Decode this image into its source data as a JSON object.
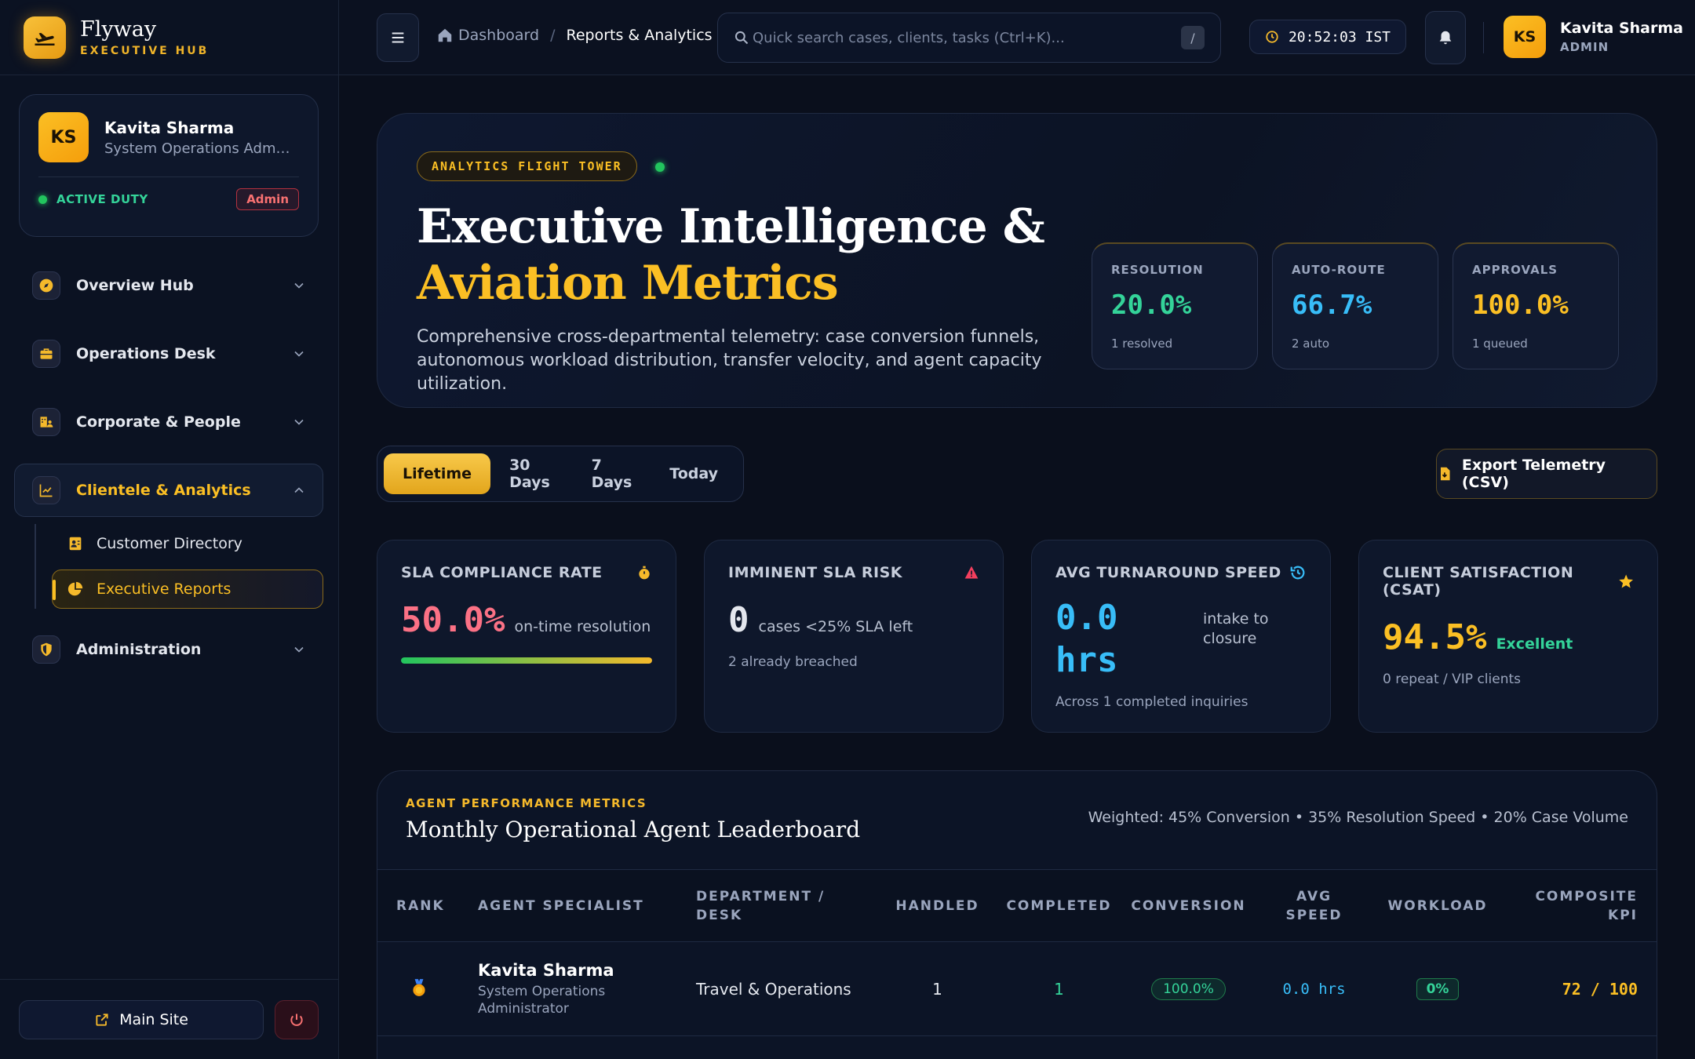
{
  "brand": {
    "name": "Flyway",
    "subtitle": "EXECUTIVE HUB"
  },
  "profile": {
    "initials": "KS",
    "name": "Kavita Sharma",
    "role": "System Operations Admini...",
    "status": "ACTIVE DUTY",
    "badge": "Admin"
  },
  "nav": {
    "overview": "Overview Hub",
    "operations": "Operations Desk",
    "corporate": "Corporate & People",
    "clientele": "Clientele & Analytics",
    "customer_directory": "Customer Directory",
    "executive_reports": "Executive Reports",
    "administration": "Administration"
  },
  "footer": {
    "main_site": "Main Site"
  },
  "topbar": {
    "breadcrumb_home": "Dashboard",
    "breadcrumb_sep": "/",
    "breadcrumb_current": "Reports & Analytics",
    "search_placeholder": "Quick search cases, clients, tasks (Ctrl+K)...",
    "search_shortcut": "/",
    "clock": "20:52:03 IST",
    "user_initials": "KS",
    "user_name": "Kavita Sharma",
    "user_role": "ADMIN"
  },
  "hero": {
    "pill": "ANALYTICS FLIGHT TOWER",
    "title_line1": "Executive Intelligence &",
    "title_line2": "Aviation Metrics",
    "description": "Comprehensive cross-departmental telemetry: case conversion funnels, autonomous workload distribution, transfer velocity, and agent capacity utilization.",
    "stats": [
      {
        "label": "RESOLUTION",
        "value": "20.0%",
        "sub": "1 resolved",
        "color": "#34d399"
      },
      {
        "label": "AUTO-ROUTE",
        "value": "66.7%",
        "sub": "2 auto",
        "color": "#38bdf8"
      },
      {
        "label": "APPROVALS",
        "value": "100.0%",
        "sub": "1 queued",
        "color": "#fbbf24"
      }
    ]
  },
  "tabs": [
    "Lifetime",
    "30 Days",
    "7 Days",
    "Today"
  ],
  "export_label": "Export Telemetry (CSV)",
  "kpis": {
    "sla": {
      "label": "SLA COMPLIANCE RATE",
      "value": "50.0%",
      "unit": "on-time resolution",
      "progress": 1.0
    },
    "risk": {
      "label": "IMMINENT SLA RISK",
      "value": "0",
      "unit": "cases <25% SLA left",
      "sub": "2 already breached"
    },
    "speed": {
      "label": "AVG TURNAROUND SPEED",
      "value_line1": "0.0",
      "value_line2": "hrs",
      "unit_line1": "intake to",
      "unit_line2": "closure",
      "sub": "Across 1 completed inquiries"
    },
    "csat": {
      "label": "CLIENT SATISFACTION (CSAT)",
      "value": "94.5%",
      "unit": "Excellent",
      "sub": "0 repeat / VIP clients"
    }
  },
  "leaderboard": {
    "kicker": "AGENT PERFORMANCE METRICS",
    "title": "Monthly Operational Agent Leaderboard",
    "weighting": "Weighted: 45% Conversion • 35% Resolution Speed • 20% Case Volume",
    "columns": {
      "rank": "RANK",
      "agent": "AGENT SPECIALIST",
      "dept_1": "DEPARTMENT /",
      "dept_2": "DESK",
      "handled": "HANDLED",
      "completed": "COMPLETED",
      "conversion": "CONVERSION",
      "speed_1": "AVG",
      "speed_2": "SPEED",
      "workload": "WORKLOAD",
      "kpi_1": "COMPOSITE",
      "kpi_2": "KPI"
    },
    "rows": [
      {
        "name": "Kavita Sharma",
        "role_1": "System Operations",
        "role_2": "Administrator",
        "department": "Travel & Operations",
        "handled": "1",
        "completed": "1",
        "conversion": "100.0%",
        "speed": "0.0 hrs",
        "workload": "0%",
        "kpi": "72 / 100"
      }
    ]
  }
}
